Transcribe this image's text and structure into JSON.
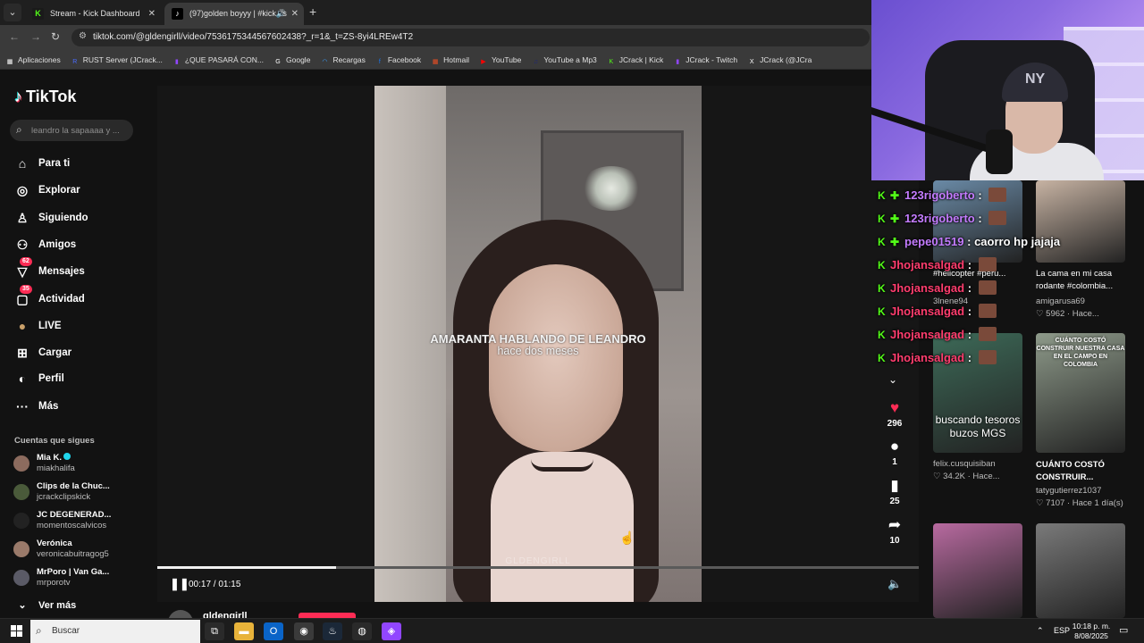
{
  "browser": {
    "tabs": [
      {
        "title": "Stream - Kick Dashboard",
        "active": false
      },
      {
        "title": "(97)golden boyyy | #kick #s",
        "active": true
      }
    ],
    "url": "tiktok.com/@gldengirll/video/7536175344567602438?_r=1&_t=ZS-8yi4LREw4T2",
    "bookmarks": [
      {
        "label": "Aplicaciones",
        "icon": "apps-grid-icon",
        "color": "#ffffff"
      },
      {
        "label": "RUST Server (JCrack...",
        "icon": "rust-icon",
        "color": "#4a6cff"
      },
      {
        "label": "¿QUE PASARÁ CON...",
        "icon": "twitch-icon",
        "color": "#9146ff"
      },
      {
        "label": "Google",
        "icon": "google-icon",
        "color": "#ffffff"
      },
      {
        "label": "Recargas",
        "icon": "recargas-icon",
        "color": "#3aa0ff"
      },
      {
        "label": "Facebook",
        "icon": "facebook-icon",
        "color": "#1877f2"
      },
      {
        "label": "Hotmail",
        "icon": "windows-icon",
        "color": "#f25022"
      },
      {
        "label": "YouTube",
        "icon": "youtube-icon",
        "color": "#ff0000"
      },
      {
        "label": "YouTube a Mp3",
        "icon": "mp3-icon",
        "color": "#1a237e"
      },
      {
        "label": "JCrack | Kick",
        "icon": "kick-icon",
        "color": "#53fc18"
      },
      {
        "label": "JCrack - Twitch",
        "icon": "twitch-icon",
        "color": "#9146ff"
      },
      {
        "label": "JCrack (@JCra",
        "icon": "x-icon",
        "color": "#ffffff"
      }
    ]
  },
  "tiktok": {
    "logo": "TikTok",
    "search_placeholder": "leandro la sapaaaa y ...",
    "nav": [
      {
        "label": "Para ti",
        "icon": "home-icon"
      },
      {
        "label": "Explorar",
        "icon": "compass-icon"
      },
      {
        "label": "Siguiendo",
        "icon": "user-follow-icon"
      },
      {
        "label": "Amigos",
        "icon": "friends-icon"
      },
      {
        "label": "Mensajes",
        "icon": "messages-icon",
        "badge": "62"
      },
      {
        "label": "Actividad",
        "icon": "activity-icon",
        "badge": "35"
      },
      {
        "label": "LIVE",
        "icon": "live-icon"
      },
      {
        "label": "Cargar",
        "icon": "upload-icon"
      },
      {
        "label": "Perfil",
        "icon": "profile-icon"
      },
      {
        "label": "Más",
        "icon": "more-icon"
      }
    ],
    "following_title": "Cuentas que sigues",
    "following": [
      {
        "name": "Mia K.",
        "handle": "miakhalifa",
        "verified": true,
        "avatar_color": "#8c6b5e"
      },
      {
        "name": "Clips de la Chuc...",
        "handle": "jcrackclipskick",
        "avatar_color": "#4a5a3a"
      },
      {
        "name": "JC DEGENERAD...",
        "handle": "momentoscalvicos",
        "avatar_color": "#222222"
      },
      {
        "name": "Verónica",
        "handle": "veronicabuitragog5",
        "avatar_color": "#9a7a6a"
      },
      {
        "name": "MrPoro | Van Ga...",
        "handle": "mrporotv",
        "avatar_color": "#5a5a66"
      }
    ],
    "see_more": "Ver más",
    "video": {
      "caption_line1": "AMARANTA HABLANDO DE LEANDRO",
      "caption_line2": "hace dos meses",
      "watermark": "GLDENGIRLL",
      "time": "00:17 / 01:15",
      "progress": 0.235,
      "author": "gldengirll"
    },
    "actions": [
      {
        "icon": "heart-icon",
        "count": "296",
        "color": "#fe2c55"
      },
      {
        "icon": "comment-icon",
        "count": "1",
        "color": "#ffffff"
      },
      {
        "icon": "bookmark-icon",
        "count": "25",
        "color": "#ffffff"
      },
      {
        "icon": "share-icon",
        "count": "10",
        "color": "#ffffff"
      }
    ],
    "related": [
      {
        "caption": "#helicopter #peru...",
        "user": "3lnene94",
        "stats": "",
        "thumb_color": "#6a8aa6"
      },
      {
        "caption": "La cama en mi casa rodante #colombia...",
        "user": "amigarusa69",
        "stats": "5962 · Hace...",
        "thumb_color": "#c7b3a3"
      },
      {
        "caption": "",
        "user": "felix.cusquisiban",
        "stats": "34.2K · Hace...",
        "thumb_color": "#3d6a58",
        "overlay": "buscando tesoros buzos MGS"
      },
      {
        "caption": "CUÁNTO COSTÓ CONSTRUIR...",
        "user": "tatygutierrez1037",
        "stats": "7107 · Hace 1 día(s)",
        "thumb_color": "#8e9a8a",
        "overlay": "CUÁNTO COSTÓ CONSTRUIR NUESTRA CASA EN EL CAMPO EN COLOMBIA"
      },
      {
        "caption": "",
        "user": "",
        "stats": "",
        "thumb_color": "#b86aa0"
      },
      {
        "caption": "",
        "user": "",
        "stats": "",
        "thumb_color": "#7a7a7a"
      }
    ]
  },
  "chat": [
    {
      "user": "123rigoberto",
      "color": "#c47cff",
      "msg": "",
      "badges": 2
    },
    {
      "user": "123rigoberto",
      "color": "#c47cff",
      "msg": "",
      "badges": 2
    },
    {
      "user": "pepe01519",
      "color": "#c47cff",
      "msg": "caorro hp jajaja",
      "badges": 2
    },
    {
      "user": "Jhojansalgad",
      "color": "#ff3d6e",
      "msg": "",
      "badges": 1
    },
    {
      "user": "Jhojansalgad",
      "color": "#ff3d6e",
      "msg": "",
      "badges": 1
    },
    {
      "user": "Jhojansalgad",
      "color": "#ff3d6e",
      "msg": "",
      "badges": 1
    },
    {
      "user": "Jhojansalgad",
      "color": "#ff3d6e",
      "msg": "",
      "badges": 1
    },
    {
      "user": "Jhojansalgad",
      "color": "#ff3d6e",
      "msg": "",
      "badges": 1
    }
  ],
  "webcam": {
    "cap_logo": "NY"
  },
  "taskbar": {
    "search_label": "Buscar",
    "tray_lang": "ESP",
    "time": "10:18 p. m.",
    "date": "8/08/2025",
    "apps": [
      {
        "icon": "task-view-icon",
        "color": "#2a2a2a"
      },
      {
        "icon": "file-explorer-icon",
        "color": "#e8b33a"
      },
      {
        "icon": "outlook-icon",
        "color": "#0a64c8"
      },
      {
        "icon": "chrome-icon",
        "color": "#3a3a3a"
      },
      {
        "icon": "steam-icon",
        "color": "#1b2838"
      },
      {
        "icon": "obs-icon",
        "color": "#2a2a2a"
      },
      {
        "icon": "twitch-app-icon",
        "color": "#9146ff"
      }
    ]
  }
}
